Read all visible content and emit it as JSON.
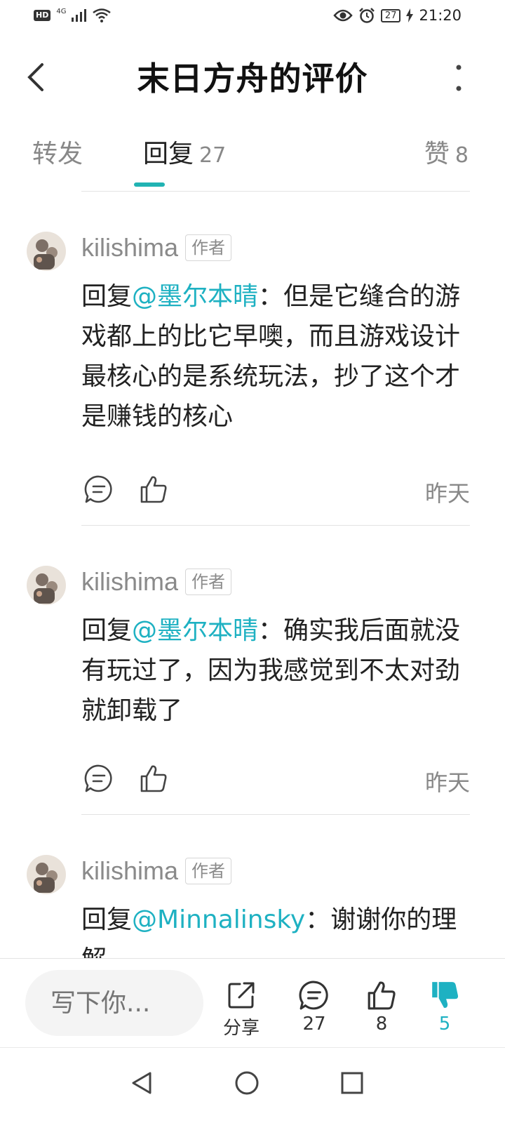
{
  "status_bar": {
    "hd": "HD",
    "network": "4G",
    "battery": "27",
    "time": "21:20"
  },
  "header": {
    "title": "末日方舟的评价"
  },
  "tabs": [
    {
      "label": "转发",
      "count": ""
    },
    {
      "label": "回复",
      "count": "27"
    },
    {
      "label": "赞",
      "count": "8"
    }
  ],
  "comments": [
    {
      "author": "kilishima",
      "badge": "作者",
      "prefix": "回复",
      "mention": "@墨尔本晴",
      "text": "：但是它缝合的游戏都上的比它早噢，而且游戏设计最核心的是系统玩法，抄了这个才是赚钱的核心",
      "date": "昨天"
    },
    {
      "author": "kilishima",
      "badge": "作者",
      "prefix": "回复",
      "mention": "@墨尔本晴",
      "text": "：确实我后面就没有玩过了，因为我感觉到不太对劲就卸载了",
      "date": "昨天"
    },
    {
      "author": "kilishima",
      "badge": "作者",
      "prefix": "回复",
      "mention": "@Minnalinsky",
      "text": "：谢谢你的理解",
      "date": ""
    }
  ],
  "bottom_bar": {
    "input_placeholder": "写下你...",
    "share_label": "分享",
    "comments_count": "27",
    "likes_count": "8",
    "dislikes_count": "5"
  },
  "colors": {
    "accent": "#1eb1c2",
    "tab_indicator": "#21b3b3"
  }
}
